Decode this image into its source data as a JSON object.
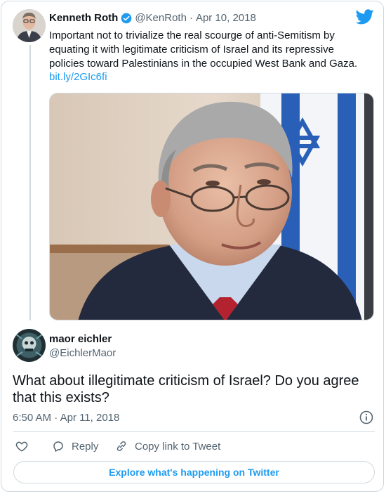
{
  "original_tweet": {
    "author_name": "Kenneth Roth",
    "handle": "@KenRoth",
    "date": "Apr 10, 2018",
    "separator": "·",
    "text": "Important not to trivialize the real scourge of anti-Semitism by equating it with legitimate criticism of Israel and its repressive policies toward Palestinians in the occupied West Bank and Gaza.",
    "link": "bit.ly/2GIc6fi",
    "verified": true
  },
  "reply": {
    "author_name": "maor eichler",
    "handle": "@EichlerMaor",
    "text": "What about illegitimate criticism of Israel? Do you agree that this exists?",
    "time": "6:50 AM",
    "separator": "·",
    "date": "Apr 11, 2018"
  },
  "actions": {
    "reply_label": "Reply",
    "copy_link_label": "Copy link to Tweet"
  },
  "explore_label": "Explore what's happening on Twitter",
  "colors": {
    "accent": "#1d9bf0",
    "text": "#0f1419",
    "muted": "#536471",
    "border": "#cfd9de"
  },
  "icons": [
    "twitter-bird-icon",
    "verified-badge-icon",
    "info-icon",
    "like-heart-icon",
    "reply-bubble-icon",
    "copy-link-icon"
  ]
}
